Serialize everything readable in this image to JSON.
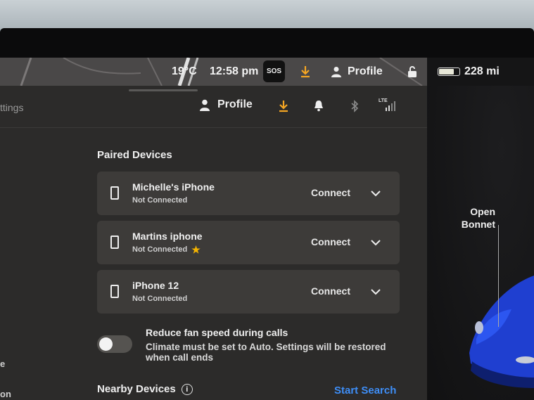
{
  "status_bar": {
    "temperature": "19°C",
    "time": "12:58 pm",
    "sos_label": "SOS",
    "profile_label": "Profile",
    "range": "228 mi",
    "battery_level": 0.75
  },
  "header": {
    "partial_title": "ttings",
    "profile_label": "Profile",
    "lte_label": "LTE"
  },
  "paired_devices": {
    "title": "Paired Devices",
    "devices": [
      {
        "name": "Michelle's iPhone",
        "status": "Not Connected",
        "favorite": false,
        "action": "Connect"
      },
      {
        "name": "Martins iphone",
        "status": "Not Connected",
        "favorite": true,
        "action": "Connect"
      },
      {
        "name": "iPhone 12",
        "status": "Not Connected",
        "favorite": false,
        "action": "Connect"
      }
    ]
  },
  "fan_speed": {
    "title": "Reduce fan speed during calls",
    "description": "Climate must be set to Auto. Settings will be restored when call ends",
    "enabled": false
  },
  "nearby": {
    "title": "Nearby Devices",
    "info_icon": "i",
    "start_search": "Start Search"
  },
  "left_edge": {
    "fragment_e": "e",
    "fragment_on": "on"
  },
  "car": {
    "open_bonnet": "Open Bonnet"
  },
  "colors": {
    "accent_orange": "#f5a623",
    "link_blue": "#3e8ef7",
    "car_blue": "#1f3fd0"
  }
}
